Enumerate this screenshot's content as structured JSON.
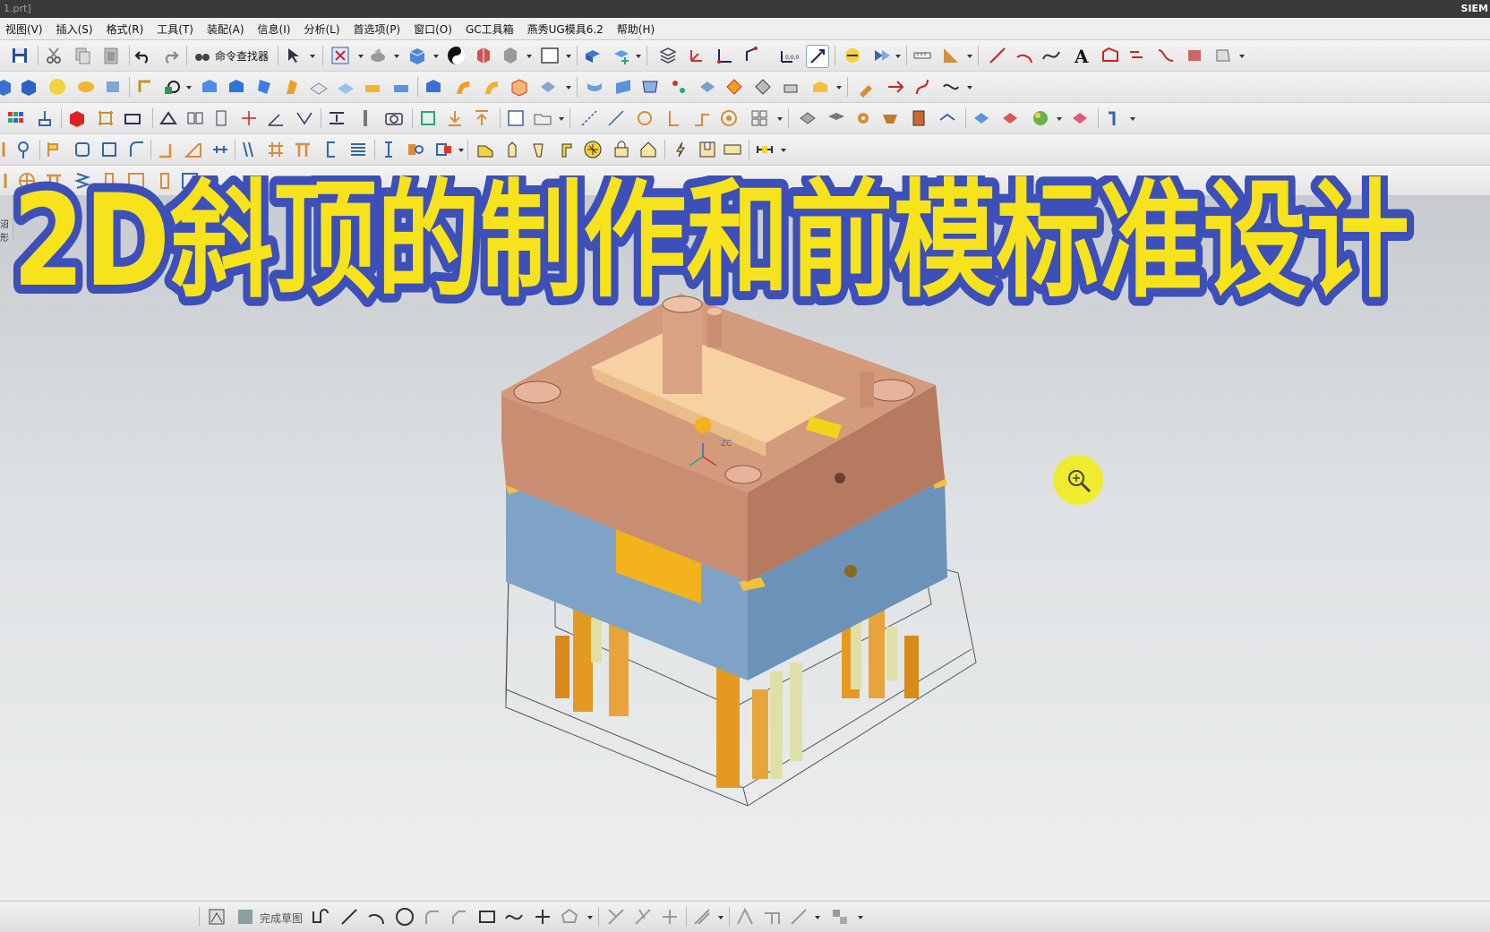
{
  "window": {
    "title_fragment": "1.prt]",
    "brand": "SIEM"
  },
  "menu": [
    {
      "label": "视图(V)"
    },
    {
      "label": "插入(S)"
    },
    {
      "label": "格式(R)"
    },
    {
      "label": "工具(T)"
    },
    {
      "label": "装配(A)"
    },
    {
      "label": "信息(I)"
    },
    {
      "label": "分析(L)"
    },
    {
      "label": "首选项(P)"
    },
    {
      "label": "窗口(O)"
    },
    {
      "label": "GC工具箱"
    },
    {
      "label": "燕秀UG模具6.2"
    },
    {
      "label": "帮助(H)"
    }
  ],
  "toolbar": {
    "command_finder_label": "命令查找器",
    "sketch_finish_label": "完成草图"
  },
  "banner": {
    "text": "2D斜顶的制作和前模标准设计",
    "fill_color": "#f7e31b",
    "outline_color": "#3d4fb8"
  },
  "viewport": {
    "triad_label": "ZC",
    "colors": {
      "a_plate": "#c98d72",
      "b_plate": "#7fa3c6",
      "core_insert": "#f6d2a2",
      "ejector_pins": "#e49a22"
    }
  },
  "left_strip": {
    "label": "沼形"
  }
}
